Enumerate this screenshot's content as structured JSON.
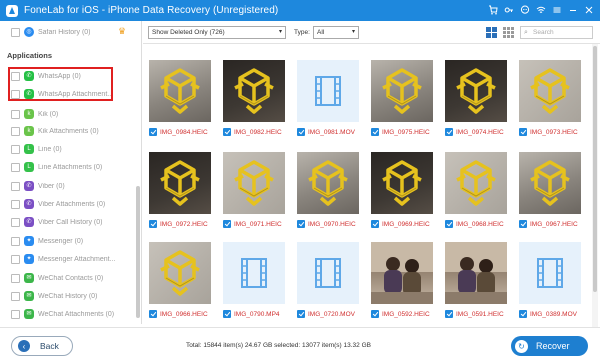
{
  "window": {
    "title": "FoneLab for iOS - iPhone Data Recovery (Unregistered)",
    "icons": [
      "cart-icon",
      "key-icon",
      "chat-icon",
      "wifi-icon",
      "menu-icon",
      "minimize-icon",
      "close-icon"
    ]
  },
  "sidebar": {
    "top_item": "Safari History (0)",
    "section_title": "Applications",
    "items": [
      {
        "label": "WhatsApp (0)",
        "icon": "whatsapp-icon",
        "color": "#25c045"
      },
      {
        "label": "WhatsApp Attachment...",
        "icon": "whatsapp-icon",
        "color": "#25c045"
      },
      {
        "label": "Kik (0)",
        "icon": "kik-icon",
        "color": "#6ac44a"
      },
      {
        "label": "Kik Attachments (0)",
        "icon": "kik-icon",
        "color": "#6ac44a"
      },
      {
        "label": "Line (0)",
        "icon": "line-icon",
        "color": "#34c14a"
      },
      {
        "label": "Line Attachments (0)",
        "icon": "line-icon",
        "color": "#34c14a"
      },
      {
        "label": "Viber (0)",
        "icon": "viber-icon",
        "color": "#7b4fc4"
      },
      {
        "label": "Viber Attachments (0)",
        "icon": "viber-icon",
        "color": "#7b4fc4"
      },
      {
        "label": "Viber Call History (0)",
        "icon": "viber-icon",
        "color": "#7b4fc4"
      },
      {
        "label": "Messenger (0)",
        "icon": "messenger-icon",
        "color": "#2a8cf0"
      },
      {
        "label": "Messenger Attachment...",
        "icon": "messenger-icon",
        "color": "#2a8cf0"
      },
      {
        "label": "WeChat Contacts (0)",
        "icon": "wechat-icon",
        "color": "#3cb64a"
      },
      {
        "label": "WeChat History (0)",
        "icon": "wechat-icon",
        "color": "#3cb64a"
      },
      {
        "label": "WeChat Attachments (0)",
        "icon": "wechat-icon",
        "color": "#3cb64a"
      }
    ]
  },
  "toolbar": {
    "filter_value": "Show Deleted Only (726)",
    "type_label": "Type:",
    "type_value": "All",
    "search_placeholder": "Search"
  },
  "grid": {
    "rows": [
      [
        {
          "name": "IMG_0984.HEIC",
          "kind": "photo"
        },
        {
          "name": "IMG_0982.HEIC",
          "kind": "photo"
        },
        {
          "name": "IMG_0981.MOV",
          "kind": "video"
        },
        {
          "name": "IMG_0975.HEIC",
          "kind": "photo"
        },
        {
          "name": "IMG_0974.HEIC",
          "kind": "photo"
        },
        {
          "name": "IMG_0973.HEIC",
          "kind": "photo"
        }
      ],
      [
        {
          "name": "IMG_0972.HEIC",
          "kind": "photo"
        },
        {
          "name": "IMG_0971.HEIC",
          "kind": "photo"
        },
        {
          "name": "IMG_0970.HEIC",
          "kind": "photo"
        },
        {
          "name": "IMG_0969.HEIC",
          "kind": "photo"
        },
        {
          "name": "IMG_0968.HEIC",
          "kind": "photo"
        },
        {
          "name": "IMG_0967.HEIC",
          "kind": "photo"
        }
      ],
      [
        {
          "name": "IMG_0966.HEIC",
          "kind": "photo"
        },
        {
          "name": "IMG_0790.MP4",
          "kind": "video"
        },
        {
          "name": "IMG_0720.MOV",
          "kind": "video"
        },
        {
          "name": "IMG_0592.HEIC",
          "kind": "people"
        },
        {
          "name": "IMG_0591.HEIC",
          "kind": "people"
        },
        {
          "name": "IMG_0389.MOV",
          "kind": "video"
        }
      ]
    ]
  },
  "footer": {
    "back_label": "Back",
    "totals": "Total: 15844 item(s) 24.67 GB   selected: 13077 item(s) 13.32 GB",
    "recover_label": "Recover"
  },
  "colors": {
    "accent": "#1e88dd",
    "filename": "#d03030",
    "highlight": "#e02020"
  }
}
